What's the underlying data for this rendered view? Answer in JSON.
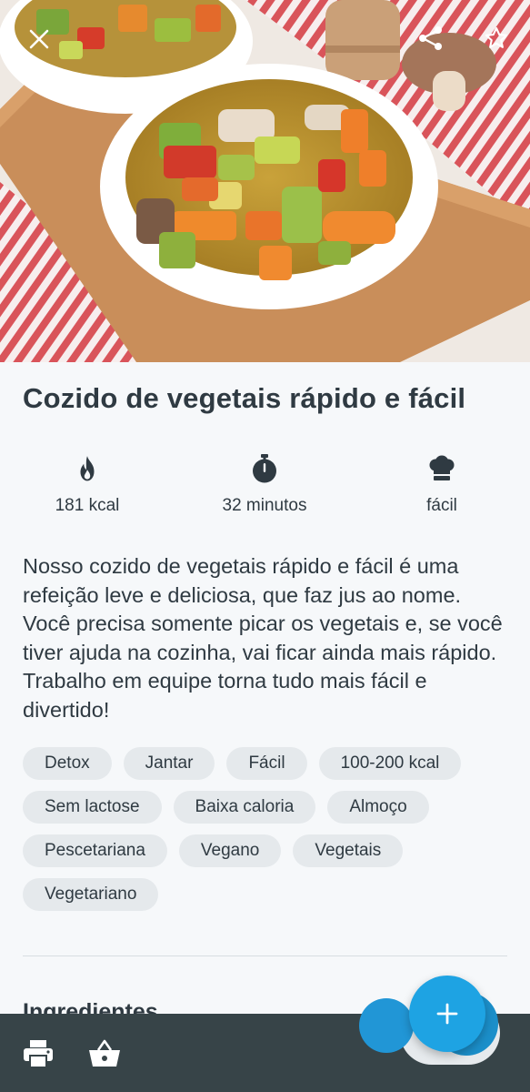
{
  "header": {
    "close_icon": "close-icon",
    "share_icon": "share-icon",
    "favorite_icon": "star-outline-icon"
  },
  "recipe": {
    "title": "Cozido de vegetais rápido e fácil",
    "stats": {
      "calories": "181 kcal",
      "time": "32 minutos",
      "difficulty": "fácil"
    },
    "description": "Nosso cozido de vegetais rápido e fácil é uma refeição leve e deliciosa, que faz jus ao nome. Você precisa somente picar os vegetais e, se você tiver ajuda na cozinha, vai ficar ainda mais rápido. Trabalho em equipe torna tudo mais fácil e divertido!",
    "tags": [
      [
        "Detox",
        "Jantar",
        "Fácil",
        "100-200 kcal"
      ],
      [
        "Sem lactose",
        "Baixa caloria",
        "Almoço"
      ],
      [
        "Pescetariana",
        "Vegano",
        "Vegetais"
      ],
      [
        "Vegetariano"
      ]
    ],
    "section_title": "Ingredientes"
  },
  "bottom_bar": {
    "print_icon": "print-icon",
    "basket_icon": "shopping-basket-icon",
    "fab_icon": "plus-icon"
  },
  "colors": {
    "accent": "#1ea3e3",
    "bottom_bar": "#374448",
    "text": "#2f3a42",
    "tag_bg": "#e5e9ec"
  }
}
